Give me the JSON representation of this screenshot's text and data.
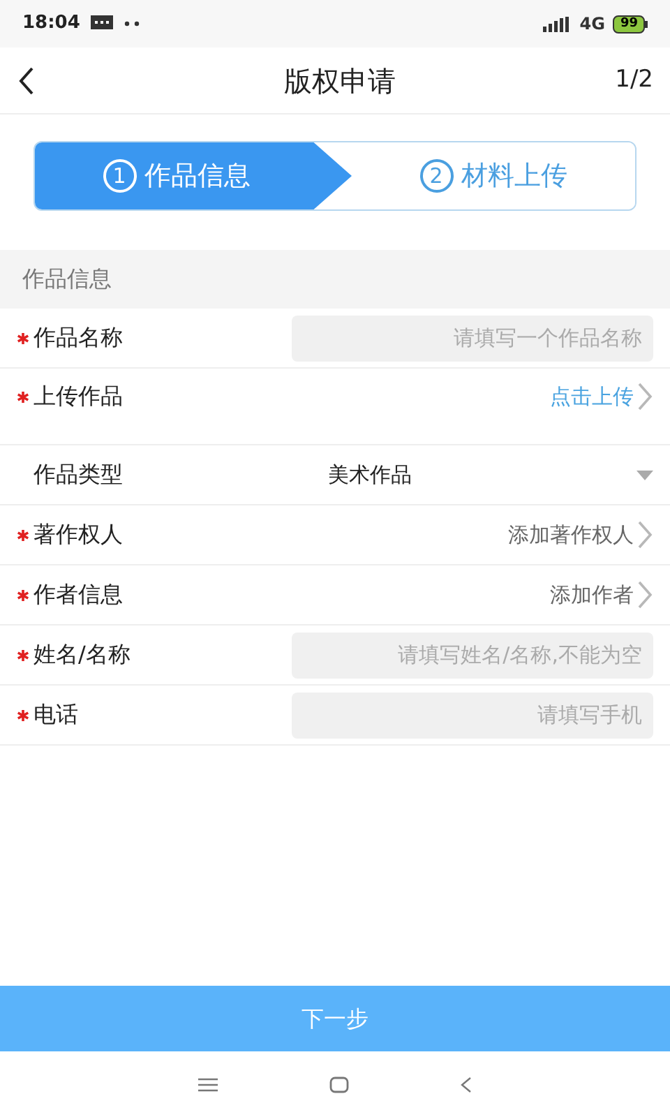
{
  "status_bar": {
    "time": "18:04",
    "network": "4G",
    "battery": "99"
  },
  "header": {
    "title": "版权申请",
    "page": "1/2"
  },
  "steps": [
    {
      "number": "1",
      "label": "作品信息",
      "selected": true
    },
    {
      "number": "2",
      "label": "材料上传",
      "selected": false
    }
  ],
  "section": {
    "title": "作品信息"
  },
  "fields": [
    {
      "kind": "input",
      "label": "作品名称",
      "required": true,
      "placeholder": "请填写一个作品名称"
    },
    {
      "kind": "link",
      "label": "上传作品",
      "required": true,
      "value": "点击上传",
      "accent": true
    },
    {
      "kind": "select",
      "label": "作品类型",
      "required": false,
      "value": "美术作品"
    },
    {
      "kind": "link",
      "label": "著作权人",
      "required": true,
      "value": "添加著作权人",
      "accent": false
    },
    {
      "kind": "link",
      "label": "作者信息",
      "required": true,
      "value": "添加作者",
      "accent": false
    },
    {
      "kind": "input",
      "label": "姓名/名称",
      "required": true,
      "placeholder": "请填写姓名/名称,不能为空"
    },
    {
      "kind": "input",
      "label": "电话",
      "required": true,
      "placeholder": "请填写手机"
    }
  ],
  "next_button": {
    "label": "下一步"
  }
}
